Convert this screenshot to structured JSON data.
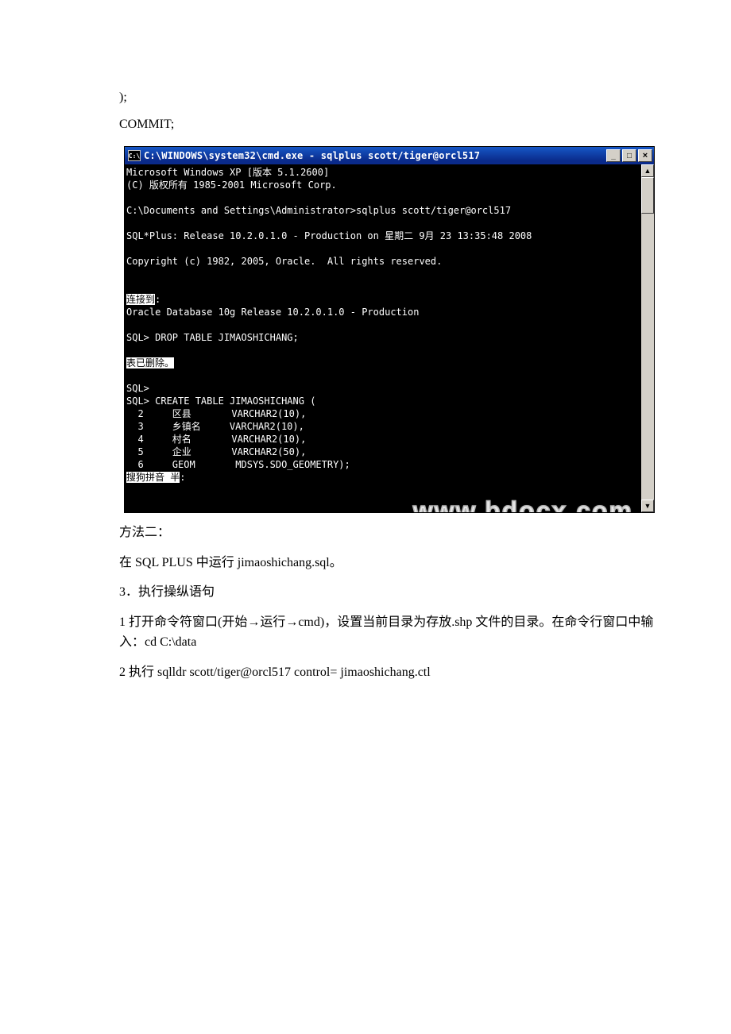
{
  "doc": {
    "line_paren": ");",
    "line_commit": "COMMIT;",
    "para_method2": "方法二：",
    "para_run_sql": "在 SQL PLUS 中运行 jimaoshichang.sql。",
    "para_step3": "3．执行操纵语句",
    "para_cd_1": "1 打开命令符窗口(开始→运行→cmd)，设置当前目录为存放.shp 文件的目录。在命令行窗口中输入：cd C:\\data",
    "para_sqlldr": "2 执行 sqlldr scott/tiger@orcl517 control= jimaoshichang.ctl"
  },
  "cmd": {
    "icon_text": "C:\\",
    "title": "C:\\WINDOWS\\system32\\cmd.exe - sqlplus scott/tiger@orcl517",
    "min": "_",
    "max": "□",
    "close": "×",
    "scroll_up": "▲",
    "scroll_down": "▼",
    "highlight_1": "连接到",
    "highlight_2": "表已删除。",
    "highlight_3": "搜狗拼音 半",
    "watermark": "www.bdocx.com",
    "lines": {
      "l1": "Microsoft Windows XP [版本 5.1.2600]",
      "l2": "(C) 版权所有 1985-2001 Microsoft Corp.",
      "l3": "",
      "l4": "C:\\Documents and Settings\\Administrator>sqlplus scott/tiger@orcl517",
      "l5": "",
      "l6": "SQL*Plus: Release 10.2.0.1.0 - Production on 星期二 9月 23 13:35:48 2008",
      "l7": "",
      "l8": "Copyright (c) 1982, 2005, Oracle.  All rights reserved.",
      "l9": "",
      "l10": "",
      "l11_after": ":",
      "l12": "Oracle Database 10g Release 10.2.0.1.0 - Production",
      "l13": "",
      "l14": "SQL> DROP TABLE JIMAOSHICHANG;",
      "l15": "",
      "l17": "",
      "l18": "SQL>",
      "l19": "SQL> CREATE TABLE JIMAOSHICHANG (",
      "l20": "  2     区县       VARCHAR2(10),",
      "l21": "  3     乡镇名     VARCHAR2(10),",
      "l22": "  4     村名       VARCHAR2(10),",
      "l23": "  5     企业       VARCHAR2(50),",
      "l24": "  6     GEOM       MDSYS.SDO_GEOMETRY);",
      "l25_after": ":"
    }
  }
}
